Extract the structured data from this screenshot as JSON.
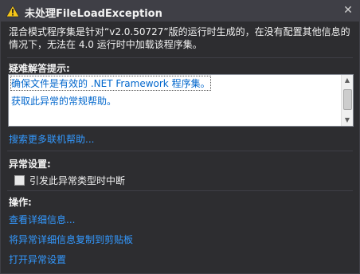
{
  "dialog": {
    "title": "未处理FileLoadException",
    "close_glyph": "✕",
    "icon": "warning-icon",
    "message": "混合模式程序集是针对“v2.0.50727”版的运行时生成的，在没有配置其他信息的情况下，无法在 4.0 运行时中加载该程序集。"
  },
  "hints": {
    "heading": "疑难解答提示:",
    "items": [
      "确保文件是有效的 .NET Framework 程序集。",
      "获取此异常的常规帮助。"
    ],
    "more_link": "搜索更多联机帮助..."
  },
  "exception_settings": {
    "heading": "异常设置:",
    "checkbox_label": "引发此异常类型时中断",
    "checked": false
  },
  "actions": {
    "heading": "操作:",
    "items": [
      "查看详细信息...",
      "将异常详细信息复制到剪贴板",
      "打开异常设置"
    ]
  },
  "colors": {
    "background": "#2d2d30",
    "titlebar": "#3f3f46",
    "link": "#3399ff",
    "warning": "#f5c518"
  }
}
